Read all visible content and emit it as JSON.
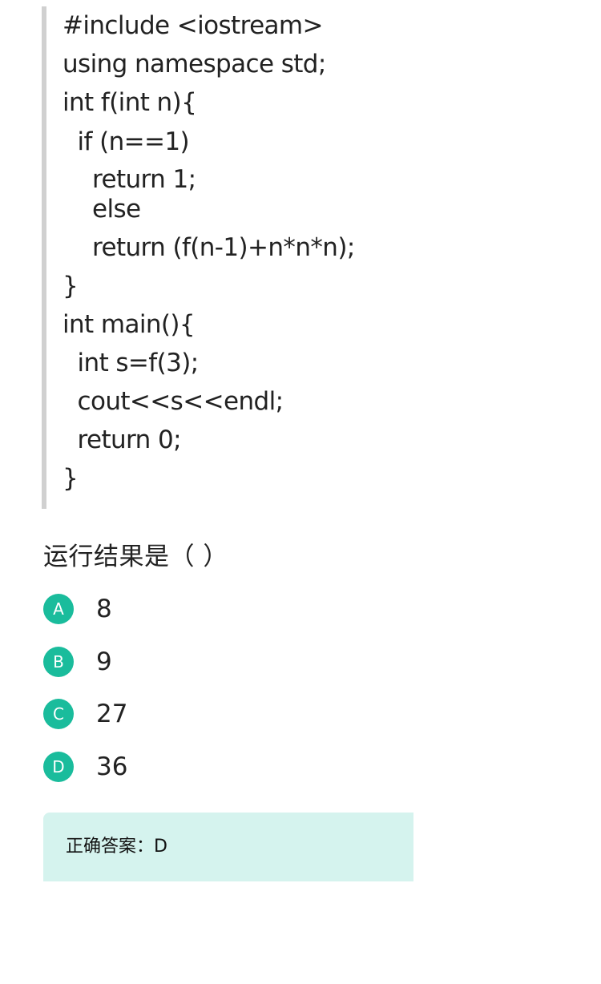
{
  "code": {
    "lines": [
      "#include <iostream>",
      "using namespace std;",
      "int f(int n){",
      "  if (n==1)",
      "    return 1;",
      "    else",
      "    return (f(n-1)+n*n*n);",
      "}",
      "int main(){",
      "  int s=f(3);",
      "  cout<<s<<endl;",
      "  return 0;",
      "}"
    ]
  },
  "question": {
    "text": "运行结果是（  ）"
  },
  "options": [
    {
      "letter": "A",
      "value": "8"
    },
    {
      "letter": "B",
      "value": "9"
    },
    {
      "letter": "C",
      "value": "27"
    },
    {
      "letter": "D",
      "value": "36"
    }
  ],
  "answer": {
    "text": "正确答案：D"
  },
  "colors": {
    "badge": "#1abc9c",
    "answer_bg": "#d5f3ee",
    "code_border": "#d0d0d0"
  }
}
